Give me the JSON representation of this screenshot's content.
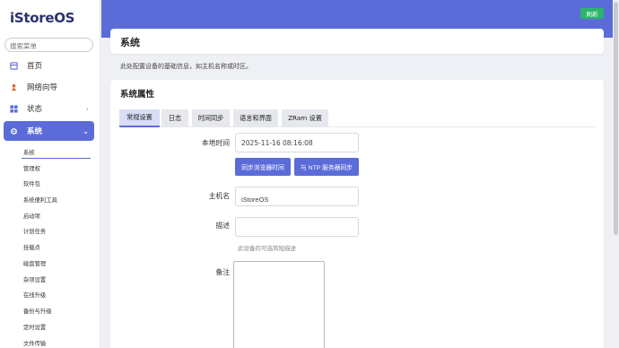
{
  "app": {
    "logo": "iStoreOS"
  },
  "sidebar": {
    "search_placeholder": "搜索菜单",
    "items": [
      {
        "label": "首页",
        "icon": "home-icon"
      },
      {
        "label": "网络向导",
        "icon": "wizard-icon"
      },
      {
        "label": "状态",
        "icon": "grid-icon"
      },
      {
        "label": "系统",
        "icon": "gear-icon"
      }
    ],
    "subitems": [
      "系统",
      "管理权",
      "软件包",
      "系统便利工具",
      "启动项",
      "计划任务",
      "挂载点",
      "磁盘管理",
      "杂项设置",
      "在线升级",
      "备份与升级",
      "定时设置",
      "文件传输"
    ]
  },
  "header": {
    "refresh_label": "刷新",
    "accent": "#5b6cd9",
    "refresh_color": "#2cb46b"
  },
  "page": {
    "title": "系统",
    "description": "此处配置设备的基础信息，如主机名称或时区。"
  },
  "section": {
    "title": "系统属性",
    "tabs": [
      "常规设置",
      "日志",
      "时间同步",
      "语言和界面",
      "ZRam 设置"
    ],
    "active_tab": "常规设置"
  },
  "form": {
    "local_time_label": "本地时间",
    "local_time_value": "2025-11-16 08:16:08",
    "sync_browser_label": "同步浏览器时间",
    "sync_ntp_label": "与 NTP 服务器同步",
    "hostname_label": "主机名",
    "hostname_value": "iStoreOS",
    "description_label": "描述",
    "description_value": "",
    "description_hint": "此设备的可选简短描述",
    "notes_label": "备注"
  }
}
